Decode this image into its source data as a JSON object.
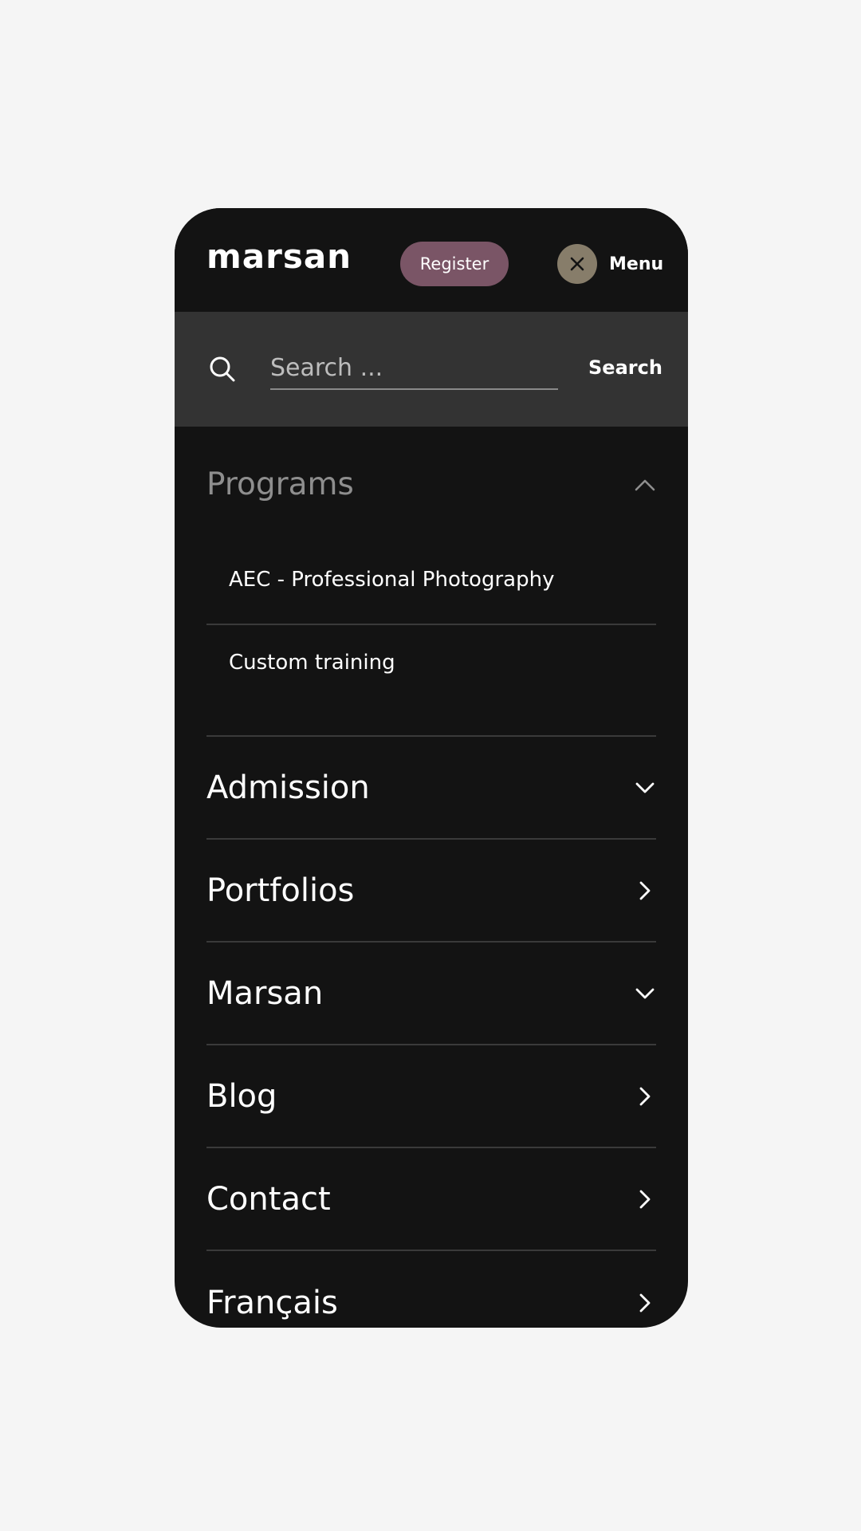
{
  "header": {
    "logo_text": "marsan",
    "register_label": "Register",
    "menu_label": "Menu"
  },
  "search": {
    "placeholder": "Search ...",
    "submit_label": "Search"
  },
  "nav": {
    "programs": {
      "label": "Programs",
      "expanded": true,
      "items": [
        {
          "label": "AEC - Professional Photography"
        },
        {
          "label": "Custom training"
        }
      ]
    },
    "items": [
      {
        "label": "Admission",
        "icon": "chevron-down-icon"
      },
      {
        "label": "Portfolios",
        "icon": "chevron-right-icon"
      },
      {
        "label": "Marsan",
        "icon": "chevron-down-icon"
      },
      {
        "label": "Blog",
        "icon": "chevron-right-icon"
      },
      {
        "label": "Contact",
        "icon": "chevron-right-icon"
      },
      {
        "label": "Français",
        "icon": "chevron-right-icon"
      }
    ]
  },
  "colors": {
    "panel_bg": "#131313",
    "search_bg": "#333333",
    "register_bg": "#7a5566",
    "close_bg": "#877d6a",
    "page_bg": "#f5f5f5"
  }
}
